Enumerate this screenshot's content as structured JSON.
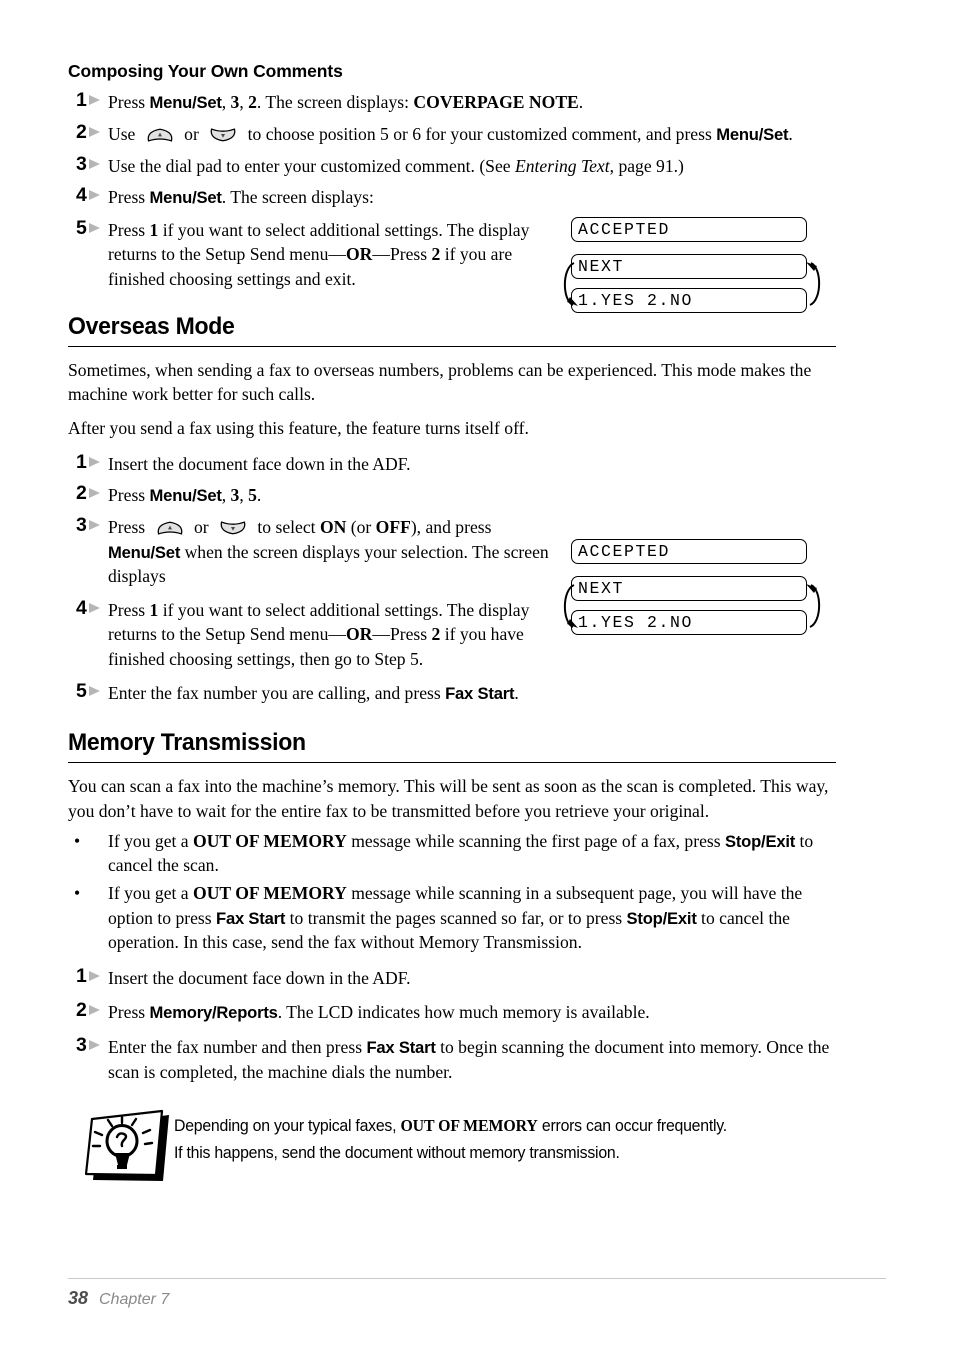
{
  "document": {
    "title": "Composing Your Own Comments",
    "footer": {
      "page_number": "38",
      "chapter": "Chapter 7"
    }
  },
  "sections": [
    {
      "id": "composing-your-own-comments",
      "heading": "Composing Your Own Comments",
      "heading_style": "sub",
      "steps": [
        {
          "num": "1",
          "parts": [
            {
              "t": "text",
              "v": "Press "
            },
            {
              "t": "key",
              "v": "Menu/Set"
            },
            {
              "t": "text",
              "v": ", "
            },
            {
              "t": "scr",
              "v": "3"
            },
            {
              "t": "text",
              "v": ", "
            },
            {
              "t": "scr",
              "v": "2"
            },
            {
              "t": "text",
              "v": ". The screen displays: "
            },
            {
              "t": "scr",
              "v": "COVERPAGE NOTE"
            },
            {
              "t": "text",
              "v": "."
            }
          ]
        },
        {
          "num": "2",
          "parts": [
            {
              "t": "text",
              "v": "Use "
            },
            {
              "t": "glyph",
              "v": "up-arrow-key-icon"
            },
            {
              "t": "text",
              "v": " or "
            },
            {
              "t": "glyph",
              "v": "down-arrow-key-icon"
            },
            {
              "t": "text",
              "v": " to choose position 5 or 6 for your customized comment, and press "
            },
            {
              "t": "key",
              "v": "Menu/Set"
            },
            {
              "t": "text",
              "v": "."
            }
          ]
        },
        {
          "num": "3",
          "parts": [
            {
              "t": "text",
              "v": "Use the dial pad to enter your customized comment. (See "
            },
            {
              "t": "ital",
              "v": "Entering Text"
            },
            {
              "t": "text",
              "v": ", page 91.)"
            }
          ]
        },
        {
          "num": "4",
          "parts": [
            {
              "t": "text",
              "v": "Press "
            },
            {
              "t": "key",
              "v": "Menu/Set"
            },
            {
              "t": "text",
              "v": ". The screen displays:"
            }
          ]
        },
        {
          "num": "5",
          "parts": [
            {
              "t": "text",
              "v": "Press "
            },
            {
              "t": "scr",
              "v": "1"
            },
            {
              "t": "text",
              "v": " if you want to select additional settings. The display returns to the Setup Send menu—"
            },
            {
              "t": "scr",
              "v": "OR"
            },
            {
              "t": "text",
              "v": "—Press "
            },
            {
              "t": "scr",
              "v": "2"
            },
            {
              "t": "text",
              "v": " if you are finished choosing settings and exit."
            }
          ]
        }
      ]
    },
    {
      "id": "overseas-mode",
      "heading": "Overseas Mode",
      "heading_style": "section",
      "paragraphs": [
        "Sometimes, when sending a fax to overseas numbers, problems can be experienced. This mode makes the machine work better for such calls.",
        "After you send a fax using this feature, the feature turns itself off."
      ],
      "steps": [
        {
          "num": "1",
          "parts": [
            {
              "t": "text",
              "v": "Insert the document face down in the ADF."
            }
          ]
        },
        {
          "num": "2",
          "parts": [
            {
              "t": "text",
              "v": "Press "
            },
            {
              "t": "key",
              "v": "Menu/Set"
            },
            {
              "t": "text",
              "v": ", "
            },
            {
              "t": "scr",
              "v": "3"
            },
            {
              "t": "text",
              "v": ", "
            },
            {
              "t": "scr",
              "v": "5"
            },
            {
              "t": "text",
              "v": "."
            }
          ]
        },
        {
          "num": "3",
          "parts": [
            {
              "t": "text",
              "v": "Press "
            },
            {
              "t": "glyph",
              "v": "up-arrow-key-icon"
            },
            {
              "t": "text",
              "v": " or "
            },
            {
              "t": "glyph",
              "v": "down-arrow-key-icon"
            },
            {
              "t": "text",
              "v": " to select "
            },
            {
              "t": "scr",
              "v": "ON"
            },
            {
              "t": "text",
              "v": " (or "
            },
            {
              "t": "scr",
              "v": "OFF"
            },
            {
              "t": "text",
              "v": "), and press "
            },
            {
              "t": "key",
              "v": "Menu/Set"
            },
            {
              "t": "text",
              "v": " when the screen displays your selection. The screen displays"
            }
          ]
        },
        {
          "num": "4",
          "parts": [
            {
              "t": "text",
              "v": "Press "
            },
            {
              "t": "scr",
              "v": "1"
            },
            {
              "t": "text",
              "v": " if you want to select additional settings. The display returns to the Setup Send menu—"
            },
            {
              "t": "scr",
              "v": "OR"
            },
            {
              "t": "text",
              "v": "—Press "
            },
            {
              "t": "scr",
              "v": "2"
            },
            {
              "t": "text",
              "v": " if you have finished choosing settings, then go to Step 5."
            }
          ]
        },
        {
          "num": "5",
          "parts": [
            {
              "t": "text",
              "v": "Enter the fax number you are calling, and press "
            },
            {
              "t": "key",
              "v": "Fax Start"
            },
            {
              "t": "text",
              "v": "."
            }
          ]
        }
      ]
    },
    {
      "id": "memory-transmission",
      "heading": "Memory Transmission",
      "heading_style": "section",
      "paragraphs": [
        "You can scan a fax into the machine’s memory. This will be sent as soon as the scan is completed. This way, you don’t have to wait for the entire fax to be transmitted before you retrieve your original."
      ],
      "bullets": [
        {
          "marker": "•",
          "parts": [
            {
              "t": "text",
              "v": "If you get a "
            },
            {
              "t": "scr",
              "v": "OUT OF MEMORY"
            },
            {
              "t": "text",
              "v": " message while scanning the first page of a fax, press "
            },
            {
              "t": "key",
              "v": "Stop/Exit"
            },
            {
              "t": "text",
              "v": " to cancel the scan."
            }
          ]
        },
        {
          "marker": "•",
          "parts": [
            {
              "t": "text",
              "v": "If you get a "
            },
            {
              "t": "scr",
              "v": "OUT OF MEMORY"
            },
            {
              "t": "text",
              "v": " message while scanning in a subsequent page, you will have the option to press "
            },
            {
              "t": "key",
              "v": "Fax Start"
            },
            {
              "t": "text",
              "v": " to transmit the pages scanned so far, or to press "
            },
            {
              "t": "key",
              "v": "Stop/Exit"
            },
            {
              "t": "text",
              "v": " to cancel the operation. In this case, send the fax without Memory Transmission."
            }
          ]
        }
      ],
      "steps": [
        {
          "num": "1",
          "parts": [
            {
              "t": "text",
              "v": "Insert the document face down in the ADF."
            }
          ]
        },
        {
          "num": "2",
          "parts": [
            {
              "t": "text",
              "v": "Press "
            },
            {
              "t": "key",
              "v": "Memory/Reports"
            },
            {
              "t": "text",
              "v": ". The LCD indicates how much memory is available."
            }
          ]
        },
        {
          "num": "3",
          "parts": [
            {
              "t": "text",
              "v": "Enter the fax number and then press "
            },
            {
              "t": "key",
              "v": "Fax Start"
            },
            {
              "t": "text",
              "v": " to begin scanning the document into memory. Once the scan is completed, the machine dials the number."
            }
          ]
        }
      ]
    }
  ],
  "lcd_diagrams": [
    {
      "id": "lcd-diagram-coverpage",
      "boxes": [
        "ACCEPTED",
        "NEXT",
        "1.YES 2.NO"
      ],
      "loop_between": [
        1,
        2
      ]
    },
    {
      "id": "lcd-diagram-overseas",
      "boxes": [
        "ACCEPTED",
        "NEXT",
        "1.YES 2.NO"
      ],
      "loop_between": [
        1,
        2
      ]
    }
  ],
  "note": {
    "icon": "lightbulb-tip-icon",
    "lines": [
      [
        {
          "t": "text",
          "v": "Depending on your typical faxes, "
        },
        {
          "t": "b",
          "v": "OUT OF MEMORY"
        },
        {
          "t": "text",
          "v": " errors can occur frequently."
        }
      ],
      [
        {
          "t": "text",
          "v": "If this happens, send the document without memory transmission."
        }
      ]
    ]
  },
  "colors": {
    "text": "#000000",
    "step_marker": "#b5b5b5",
    "footer_text": "#8a8a8a",
    "footer_page": "#4d4d4d",
    "rule": "#000000",
    "footer_rule": "#c9c9c9"
  }
}
